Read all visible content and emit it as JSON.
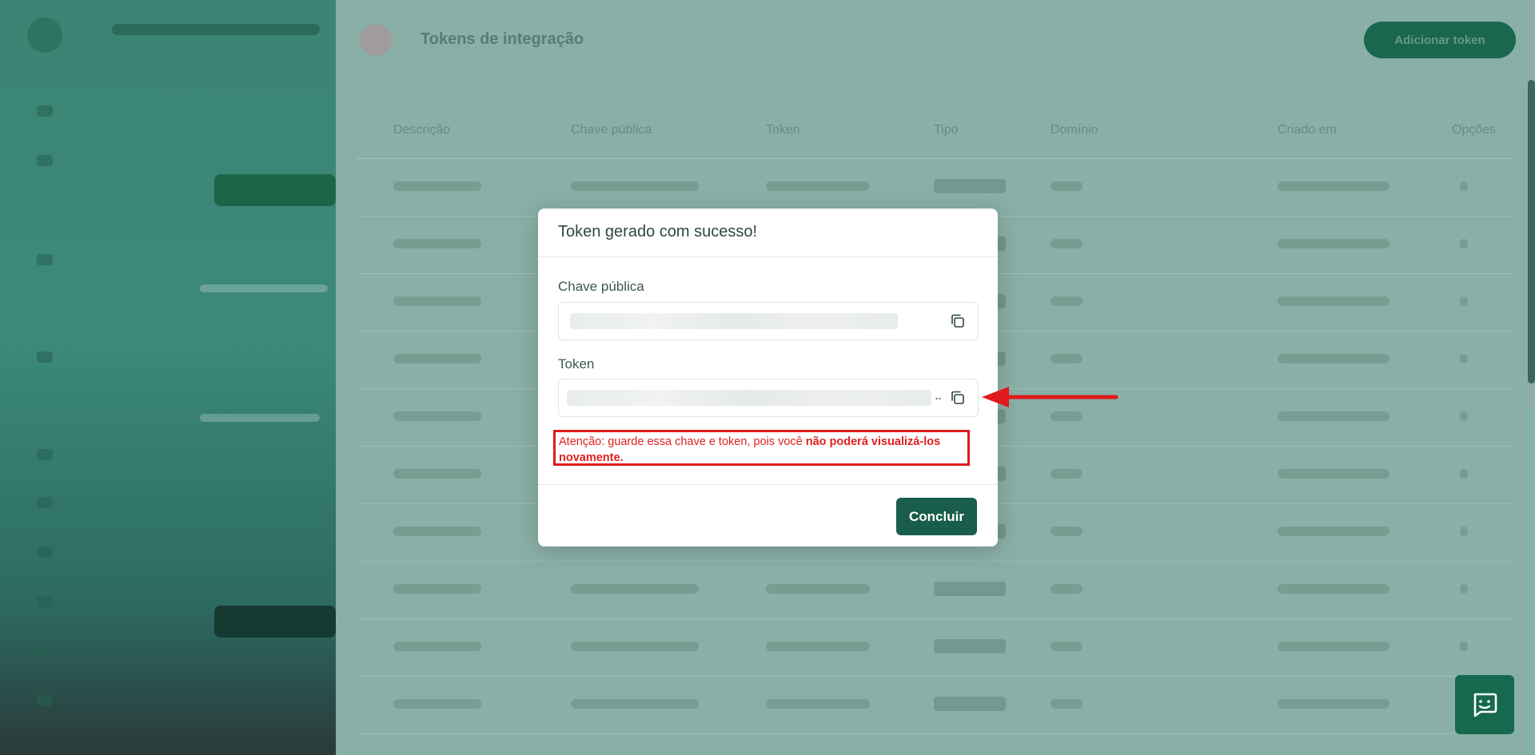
{
  "background": {
    "page_title": "Tokens de integração",
    "add_button_label": "Adicionar token",
    "table_headers": [
      "Descrição",
      "Chave pública",
      "Token",
      "Tipo",
      "Domínio",
      "Criado em",
      "Opções"
    ]
  },
  "modal": {
    "title": "Token gerado com sucesso!",
    "public_key_label": "Chave pública",
    "token_label": "Token",
    "token_ellipsis": "..",
    "warning_prefix": "Atenção: guarde essa chave e token, pois você ",
    "warning_bold": "não poderá visualizá-los novamente.",
    "done_button": "Concluir"
  },
  "colors": {
    "primary": "#185e4a",
    "warning": "#e01b1b",
    "overlay_tint": "#8fb7ad"
  },
  "icons": {
    "copy": "copy-icon",
    "chat": "chat-icon",
    "arrow": "red-arrow-annotation"
  }
}
